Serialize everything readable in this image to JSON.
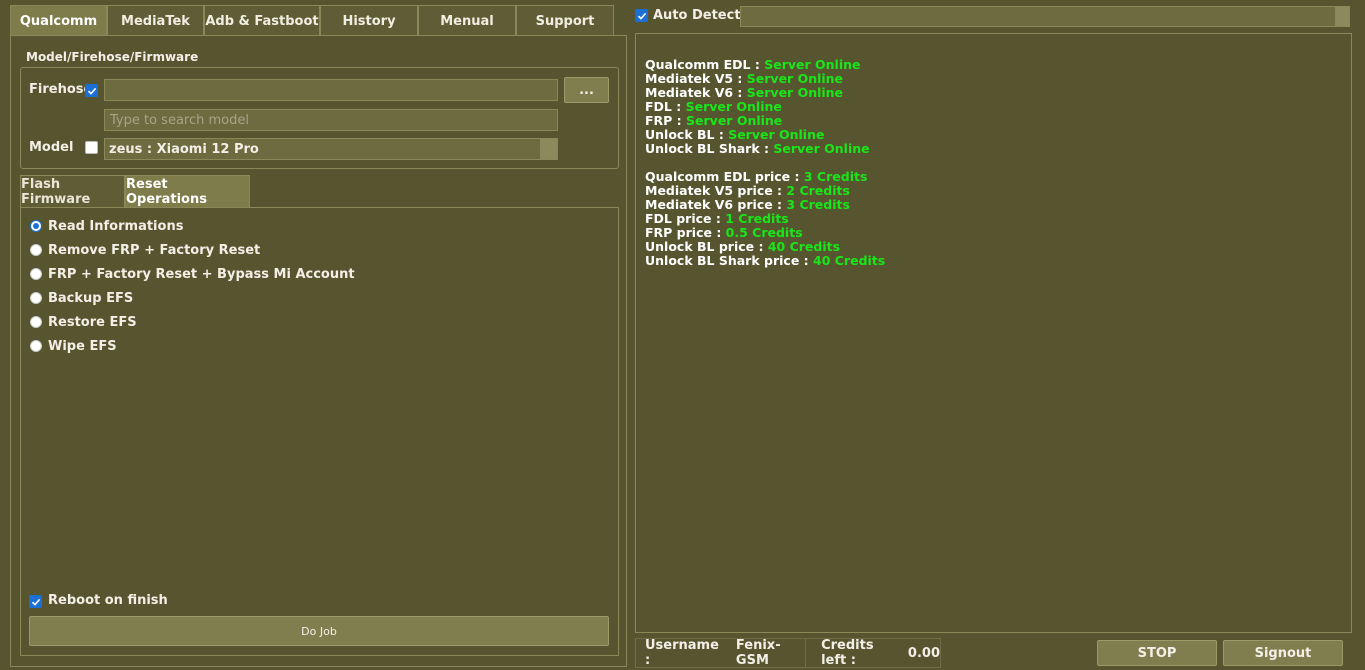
{
  "top_tabs": [
    "Qualcomm",
    "MediaTek",
    "Adb & Fastboot",
    "History",
    "Menual",
    "Support"
  ],
  "auto_detect_label": "Auto Detect",
  "group_title": "Model/Firehose/Firmware",
  "firehose_label": "Firehose",
  "browse_button": "...",
  "search_placeholder": "Type to search model",
  "model_label": "Model",
  "model_value": "zeus : Xiaomi 12 Pro",
  "sub_tabs": [
    "Flash Firmware",
    "Reset Operations"
  ],
  "options": [
    "Read Informations",
    "Remove FRP +  Factory Reset",
    "FRP + Factory Reset + Bypass Mi Account",
    "Backup EFS",
    "Restore EFS",
    "Wipe EFS"
  ],
  "reboot_label": "Reboot on finish",
  "do_job_button": "Do Job",
  "log": {
    "servers": [
      {
        "label": "Qualcomm EDL : ",
        "value": "Server Online"
      },
      {
        "label": "Mediatek V5 : ",
        "value": "Server Online"
      },
      {
        "label": "Mediatek V6 : ",
        "value": "Server Online"
      },
      {
        "label": "FDL : ",
        "value": "Server Online"
      },
      {
        "label": "FRP : ",
        "value": "Server Online"
      },
      {
        "label": "Unlock BL : ",
        "value": "Server Online"
      },
      {
        "label": "Unlock BL Shark : ",
        "value": "Server Online"
      }
    ],
    "prices": [
      {
        "label": "Qualcomm EDL price : ",
        "value": "3 Credits"
      },
      {
        "label": "Mediatek V5 price : ",
        "value": "2 Credits"
      },
      {
        "label": "Mediatek V6 price : ",
        "value": "3 Credits"
      },
      {
        "label": "FDL price : ",
        "value": "1 Credits"
      },
      {
        "label": "FRP price : ",
        "value": "0.5 Credits"
      },
      {
        "label": "Unlock BL price : ",
        "value": "40 Credits"
      },
      {
        "label": "Unlock BL Shark price : ",
        "value": "40 Credits"
      }
    ]
  },
  "status": {
    "username_label": "Username :",
    "username_value": "Fenix-GSM",
    "credits_label": "Credits left :",
    "credits_value": "0.00"
  },
  "stop_button": "STOP",
  "signout_button": "Signout",
  "colors": {
    "background": "#57552f",
    "accent_blue": "#1c6fd4",
    "online_green": "#19e619"
  }
}
